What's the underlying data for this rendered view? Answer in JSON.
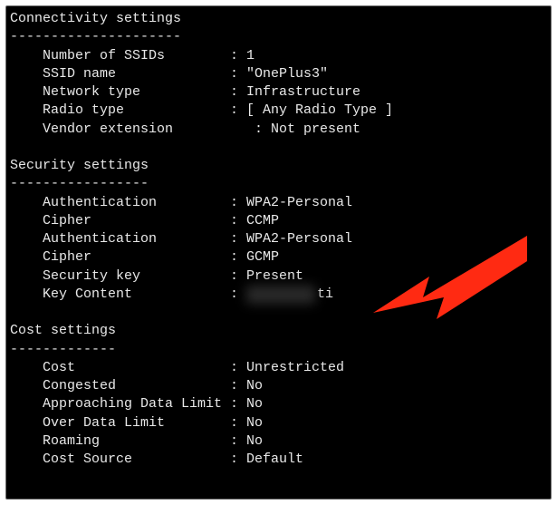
{
  "sections": {
    "connectivity": {
      "title": "Connectivity settings",
      "divider": "---------------------",
      "rows": [
        {
          "key": "Number of SSIDs",
          "value": "1"
        },
        {
          "key": "SSID name",
          "value": "\"OnePlus3\""
        },
        {
          "key": "Network type",
          "value": "Infrastructure"
        },
        {
          "key": "Radio type",
          "value": "[ Any Radio Type ]"
        },
        {
          "key": "Vendor extension",
          "value": "Not present"
        }
      ]
    },
    "security": {
      "title": "Security settings",
      "divider": "-----------------",
      "rows": [
        {
          "key": "Authentication",
          "value": "WPA2-Personal"
        },
        {
          "key": "Cipher",
          "value": "CCMP"
        },
        {
          "key": "Authentication",
          "value": "WPA2-Personal"
        },
        {
          "key": "Cipher",
          "value": "GCMP"
        },
        {
          "key": "Security key",
          "value": "Present"
        },
        {
          "key": "Key Content",
          "redacted": "████████",
          "partial": "ti"
        }
      ]
    },
    "cost": {
      "title": "Cost settings",
      "divider": "-------------",
      "rows": [
        {
          "key": "Cost",
          "value": "Unrestricted"
        },
        {
          "key": "Congested",
          "value": "No"
        },
        {
          "key": "Approaching Data Limit",
          "value": "No"
        },
        {
          "key": "Over Data Limit",
          "value": "No"
        },
        {
          "key": "Roaming",
          "value": "No"
        },
        {
          "key": "Cost Source",
          "value": "Default"
        }
      ]
    }
  },
  "colon": ":",
  "arrow_color": "#ff2a12"
}
